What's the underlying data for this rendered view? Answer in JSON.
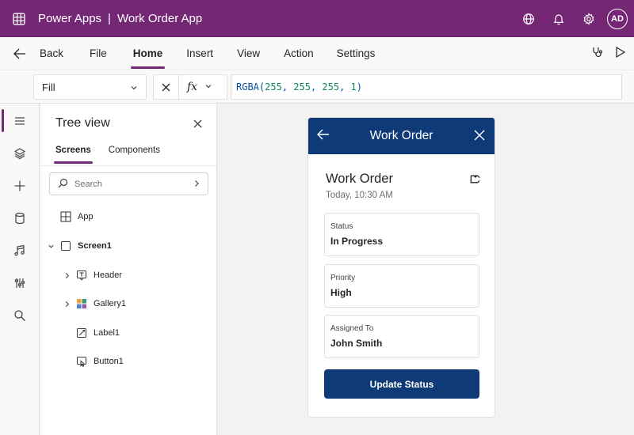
{
  "topbar": {
    "product": "Power Apps",
    "separator": "|",
    "app_name": "Work Order App",
    "avatar_initials": "AD",
    "bg_color": "#742774"
  },
  "command_bar": {
    "items": [
      {
        "label": "Back",
        "active": false
      },
      {
        "label": "File",
        "active": false
      },
      {
        "label": "Home",
        "active": true
      },
      {
        "label": "Insert",
        "active": false
      },
      {
        "label": "View",
        "active": false
      },
      {
        "label": "Action",
        "active": false
      },
      {
        "label": "Settings",
        "active": false
      }
    ],
    "right_icons": [
      "stethoscope-icon",
      "play-icon"
    ]
  },
  "formula_bar": {
    "property": "Fill",
    "fx_label": "fx",
    "formula_fn": "RGBA(",
    "formula_args": [
      "255",
      "255",
      "255",
      "1"
    ],
    "formula_close": ")"
  },
  "rail": {
    "icons": [
      "hamburger-icon",
      "layers-icon",
      "plus-icon",
      "database-icon",
      "media-icon",
      "advanced-tools-icon",
      "search-icon"
    ]
  },
  "tree_view": {
    "title": "Tree view",
    "tabs": [
      {
        "label": "Screens",
        "active": true
      },
      {
        "label": "Components",
        "active": false
      }
    ],
    "search_placeholder": "Search",
    "nodes": [
      {
        "label": "App",
        "icon": "app-grid-icon"
      },
      {
        "label": "Screen1",
        "icon": "screen-icon"
      },
      {
        "label": "Header",
        "icon": "text-label-icon"
      },
      {
        "label": "Gallery1",
        "icon": "gallery-icon"
      },
      {
        "label": "Label1",
        "icon": "edit-label-icon"
      },
      {
        "label": "Button1",
        "icon": "button-icon"
      }
    ]
  },
  "phone": {
    "header_title": "Work Order",
    "header_color": "#0f3a78",
    "title": "Work Order",
    "timestamp": "Today, 10:30 AM",
    "fields": [
      {
        "label": "Status",
        "value": "In Progress"
      },
      {
        "label": "Priority",
        "value": "High"
      },
      {
        "label": "Assigned To",
        "value": "John Smith"
      }
    ],
    "button_label": "Update Status"
  }
}
